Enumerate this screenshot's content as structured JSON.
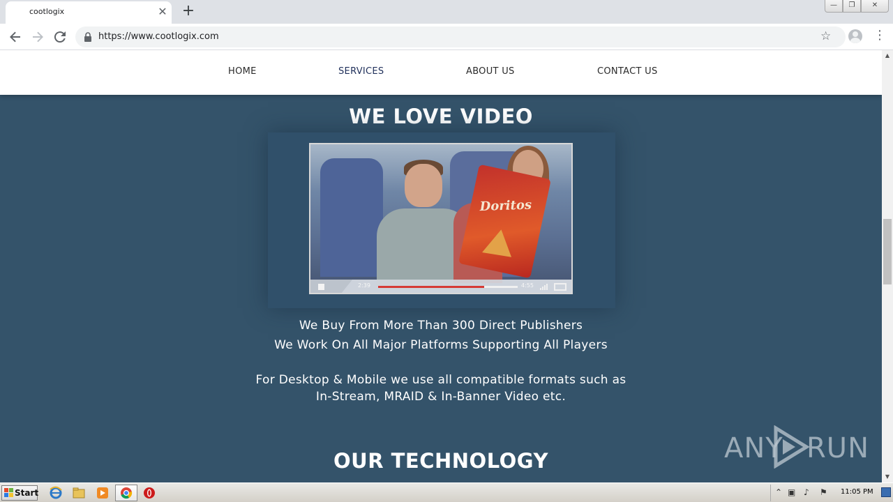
{
  "browser": {
    "tab_title": "cootlogix",
    "tab_close": "✕",
    "new_tab": "+",
    "url": "https://www.cootlogix.com",
    "window_controls": {
      "minimize": "—",
      "maximize": "❐",
      "close": "✕"
    }
  },
  "site": {
    "nav": [
      {
        "label": "HOME"
      },
      {
        "label": "SERVICES",
        "active": true
      },
      {
        "label": "ABOUT US"
      },
      {
        "label": "CONTACT US"
      }
    ],
    "video_heading": "WE LOVE VIDEO",
    "video": {
      "bag_logo": "Doritos",
      "current_time": "2:39",
      "duration": "4:55",
      "progress": 0.76
    },
    "copy": {
      "line1": "We Buy From More Than 300 Direct Publishers",
      "line2": "We Work On All Major Platforms Supporting All Players",
      "line3": "For Desktop & Mobile we use all compatible formats such as",
      "line4": "In-Stream, MRAID & In-Banner Video etc."
    },
    "tech_heading": "OUR TECHNOLOGY"
  },
  "watermark": {
    "left": "ANY",
    "right": "RUN"
  },
  "taskbar": {
    "start_label": "Start",
    "clock": "11:05 PM"
  },
  "colors": {
    "page_bg": "#34536a",
    "nav_bg": "#ffffff",
    "progress": "#d63a35"
  }
}
